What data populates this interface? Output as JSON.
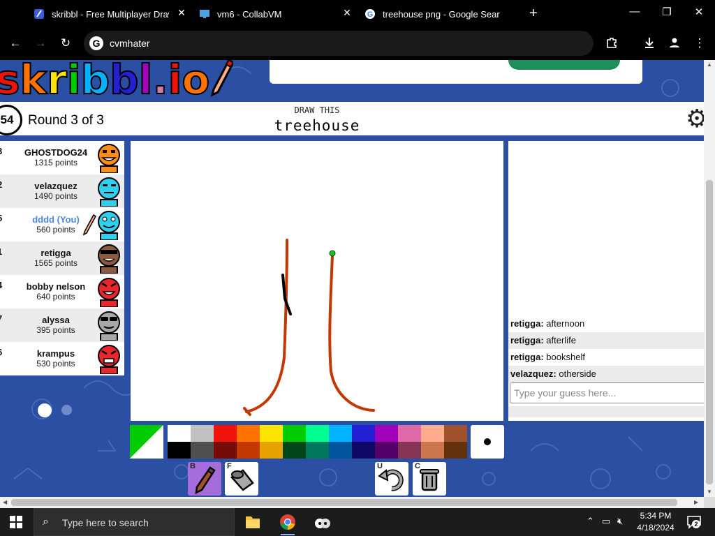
{
  "browser": {
    "tabs": [
      {
        "title": "skribbl - Free Multiplayer Draw",
        "favicon": "skribbl-favicon"
      },
      {
        "title": "vm6 - CollabVM",
        "favicon": "monitor-favicon"
      },
      {
        "title": "treehouse png - Google Search",
        "favicon": "google-favicon"
      }
    ],
    "new_tab": "+",
    "address": "cvmhater"
  },
  "header": {
    "logo_letters": [
      "s",
      "k",
      "r",
      "i",
      "b",
      "b",
      "l",
      ".",
      "i",
      "o",
      "!"
    ],
    "logo_colors": [
      "#ef130b",
      "#ff7100",
      "#ffe400",
      "#00cc00",
      "#00b2ff",
      "#231fd3",
      "#a300ba",
      "#d37caa",
      "#ef130b",
      "#ff7100",
      "#ffe400"
    ],
    "timer": "54",
    "round_text": "Round 3 of 3",
    "draw_label": "DRAW THIS",
    "word": "treehouse"
  },
  "players": [
    {
      "rank": "3",
      "name": "GHOSTDOG24",
      "points": "1315 points",
      "color": "#ff8c1a",
      "you": false,
      "drawing": false,
      "face": "grin"
    },
    {
      "rank": "2",
      "name": "velazquez",
      "points": "1490 points",
      "color": "#2ed0f0",
      "you": false,
      "drawing": false,
      "face": "flat"
    },
    {
      "rank": "5",
      "name": "dddd (You)",
      "points": "560 points",
      "color": "#2ed0f0",
      "you": true,
      "drawing": true,
      "face": "happy"
    },
    {
      "rank": "1",
      "name": "retigga",
      "points": "1565 points",
      "color": "#8b5a3c",
      "you": false,
      "drawing": false,
      "face": "shades"
    },
    {
      "rank": "4",
      "name": "bobby nelson",
      "points": "640 points",
      "color": "#e8262c",
      "you": false,
      "drawing": false,
      "face": "angry"
    },
    {
      "rank": "7",
      "name": "alyssa",
      "points": "395 points",
      "color": "#a8a8a8",
      "you": false,
      "drawing": false,
      "face": "shades"
    },
    {
      "rank": "6",
      "name": "krampus",
      "points": "530 points",
      "color": "#e8262c",
      "you": false,
      "drawing": false,
      "face": "mad"
    }
  ],
  "chat": {
    "messages": [
      {
        "user": "retigga:",
        "text": "afternoon"
      },
      {
        "user": "retigga:",
        "text": "afterlife"
      },
      {
        "user": "retigga:",
        "text": "bookshelf"
      },
      {
        "user": "velazquez:",
        "text": "otherside"
      }
    ],
    "placeholder": "Type your guess here..."
  },
  "palette": {
    "top": [
      "#ffffff",
      "#c1c1c1",
      "#ef130b",
      "#ff7100",
      "#ffe400",
      "#00cc00",
      "#00ff91",
      "#00b2ff",
      "#231fd3",
      "#a300ba",
      "#df69a7",
      "#ffac8e",
      "#a0522d"
    ],
    "bottom": [
      "#000000",
      "#505050",
      "#740b07",
      "#c23800",
      "#e8a200",
      "#004619",
      "#00785d",
      "#00569e",
      "#0e0865",
      "#550069",
      "#873554",
      "#cc774d",
      "#63300d"
    ],
    "primary": "#00cc00",
    "secondary": "#ffffff"
  },
  "tools": [
    {
      "key": "B",
      "name": "brush",
      "active": true
    },
    {
      "key": "F",
      "name": "fill",
      "active": false
    },
    {
      "key": "U",
      "name": "undo",
      "active": false
    },
    {
      "key": "C",
      "name": "clear",
      "active": false
    }
  ],
  "taskbar": {
    "search_placeholder": "Type here to search",
    "time": "5:34 PM",
    "date": "4/18/2024",
    "notification_count": "2"
  }
}
